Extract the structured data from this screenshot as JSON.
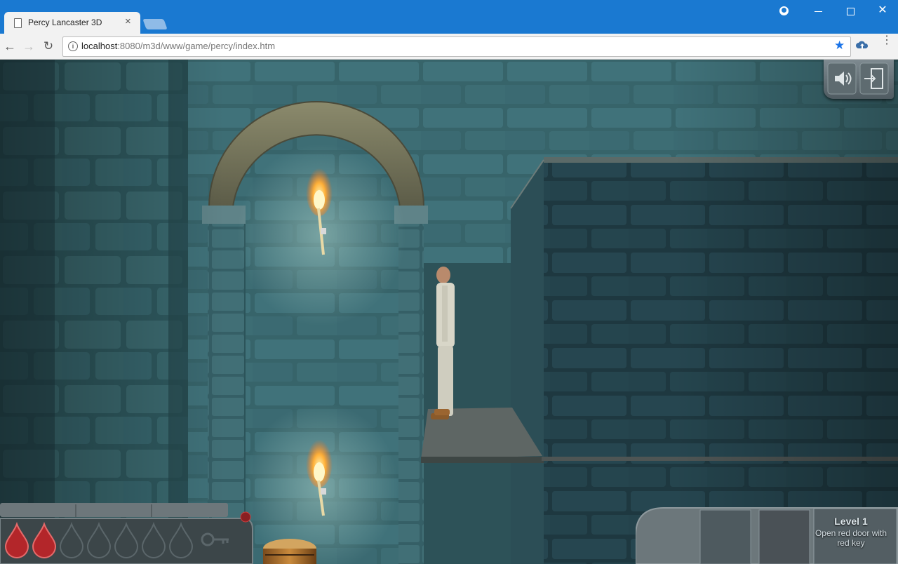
{
  "browser": {
    "tab_title": "Percy Lancaster 3D",
    "tab_close": "×",
    "url_host": "localhost",
    "url_rest": ":8080/m3d/www/game/percy/index.htm",
    "back": "←",
    "forward": "→",
    "reload": "↻",
    "bookmark_star": "★",
    "menu": "⋮",
    "info": "i",
    "close_window": "✕"
  },
  "hud": {
    "level_title": "Level 1",
    "objective": "Open red door with red key",
    "blood_drops_filled": 2,
    "blood_drops_total": 8,
    "has_key": false
  },
  "colors": {
    "chrome_blue": "#1a79d1",
    "stone": "#3f6e72",
    "torch_flame": "#ff9a2a",
    "blood": "#b3262a"
  }
}
